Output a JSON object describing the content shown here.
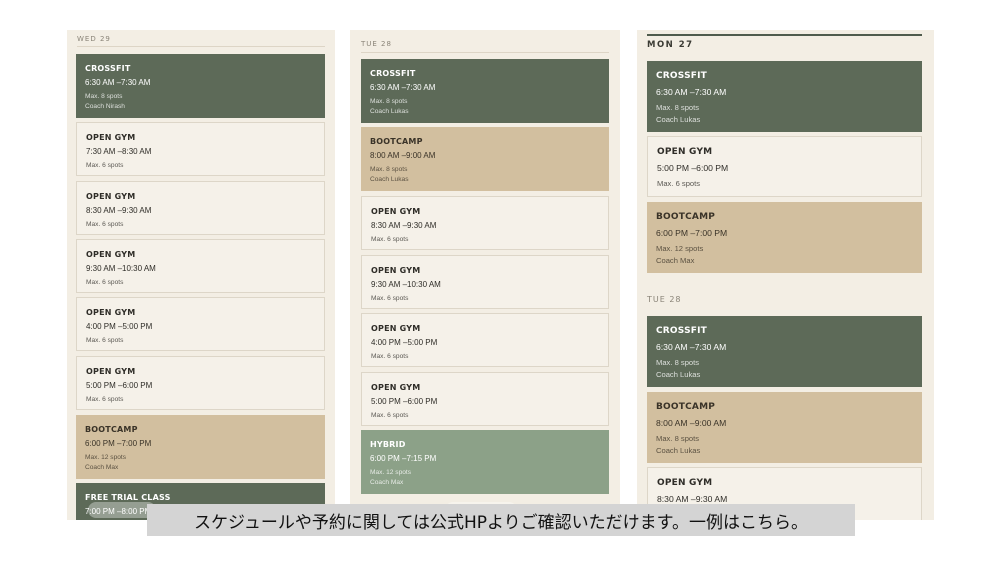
{
  "panel1": {
    "day": "WED 29",
    "cards": [
      {
        "title": "CROSSFIT",
        "time": "6:30 AM –7:30 AM",
        "meta": [
          "Max. 8 spots",
          "Coach Nirash"
        ],
        "style": "dark"
      },
      {
        "title": "OPEN GYM",
        "time": "7:30 AM –8:30 AM",
        "meta": [
          "Max. 6 spots"
        ],
        "style": "light"
      },
      {
        "title": "OPEN GYM",
        "time": "8:30 AM –9:30 AM",
        "meta": [
          "Max. 6 spots"
        ],
        "style": "light"
      },
      {
        "title": "OPEN GYM",
        "time": "9:30 AM –10:30 AM",
        "meta": [
          "Max. 6 spots"
        ],
        "style": "light"
      },
      {
        "title": "OPEN GYM",
        "time": "4:00 PM –5:00 PM",
        "meta": [
          "Max. 6 spots"
        ],
        "style": "light"
      },
      {
        "title": "OPEN GYM",
        "time": "5:00 PM –6:00 PM",
        "meta": [
          "Max. 6 spots"
        ],
        "style": "light"
      },
      {
        "title": "BOOTCAMP",
        "time": "6:00 PM –7:00 PM",
        "meta": [
          "Max. 12 spots",
          "Coach Max"
        ],
        "style": "tan"
      },
      {
        "title": "FREE TRIAL CLASS",
        "time": "7:00 PM –8:00 PM",
        "meta": [],
        "style": "dark"
      }
    ]
  },
  "panel2": {
    "day": "TUE 28",
    "cards": [
      {
        "title": "CROSSFIT",
        "time": "6:30 AM –7:30 AM",
        "meta": [
          "Max. 8 spots",
          "Coach Lukas"
        ],
        "style": "dark"
      },
      {
        "title": "BOOTCAMP",
        "time": "8:00 AM –9:00 AM",
        "meta": [
          "Max. 8 spots",
          "Coach Lukas"
        ],
        "style": "tan"
      },
      {
        "title": "OPEN GYM",
        "time": "8:30 AM –9:30 AM",
        "meta": [
          "Max. 6 spots"
        ],
        "style": "light"
      },
      {
        "title": "OPEN GYM",
        "time": "9:30 AM –10:30 AM",
        "meta": [
          "Max. 6 spots"
        ],
        "style": "light"
      },
      {
        "title": "OPEN GYM",
        "time": "4:00 PM –5:00 PM",
        "meta": [
          "Max. 6 spots"
        ],
        "style": "light"
      },
      {
        "title": "OPEN GYM",
        "time": "5:00 PM –6:00 PM",
        "meta": [
          "Max. 6 spots"
        ],
        "style": "light"
      },
      {
        "title": "HYBRID",
        "time": "6:00 PM –7:15 PM",
        "meta": [
          "Max. 12 spots",
          "Coach Max"
        ],
        "style": "sage"
      }
    ]
  },
  "panel3": {
    "day1": "MON 27",
    "cards1": [
      {
        "title": "CROSSFIT",
        "time": "6:30 AM –7:30 AM",
        "meta": [
          "Max. 8 spots",
          "Coach Lukas"
        ],
        "style": "dark"
      },
      {
        "title": "OPEN GYM",
        "time": "5:00 PM –6:00 PM",
        "meta": [
          "Max. 6 spots"
        ],
        "style": "light"
      },
      {
        "title": "BOOTCAMP",
        "time": "6:00 PM –7:00 PM",
        "meta": [
          "Max. 12 spots",
          "Coach Max"
        ],
        "style": "tan"
      }
    ],
    "day2": "TUE 28",
    "cards2": [
      {
        "title": "CROSSFIT",
        "time": "6:30 AM –7:30 AM",
        "meta": [
          "Max. 8 spots",
          "Coach Lukas"
        ],
        "style": "dark"
      },
      {
        "title": "BOOTCAMP",
        "time": "8:00 AM –9:00 AM",
        "meta": [
          "Max. 8 spots",
          "Coach Lukas"
        ],
        "style": "tan"
      },
      {
        "title": "OPEN GYM",
        "time": "8:30 AM –9:30 AM",
        "meta": [],
        "style": "light"
      }
    ]
  },
  "subtitle": "スケジュールや予約に関しては公式HPよりご確認いただけます。一例はこちら。",
  "colors": {
    "dark": "#5d6a58",
    "tan": "#d2bf9f",
    "light": "#f5f1e9",
    "sage": "#8ca188",
    "panel": "#f3eee4"
  }
}
